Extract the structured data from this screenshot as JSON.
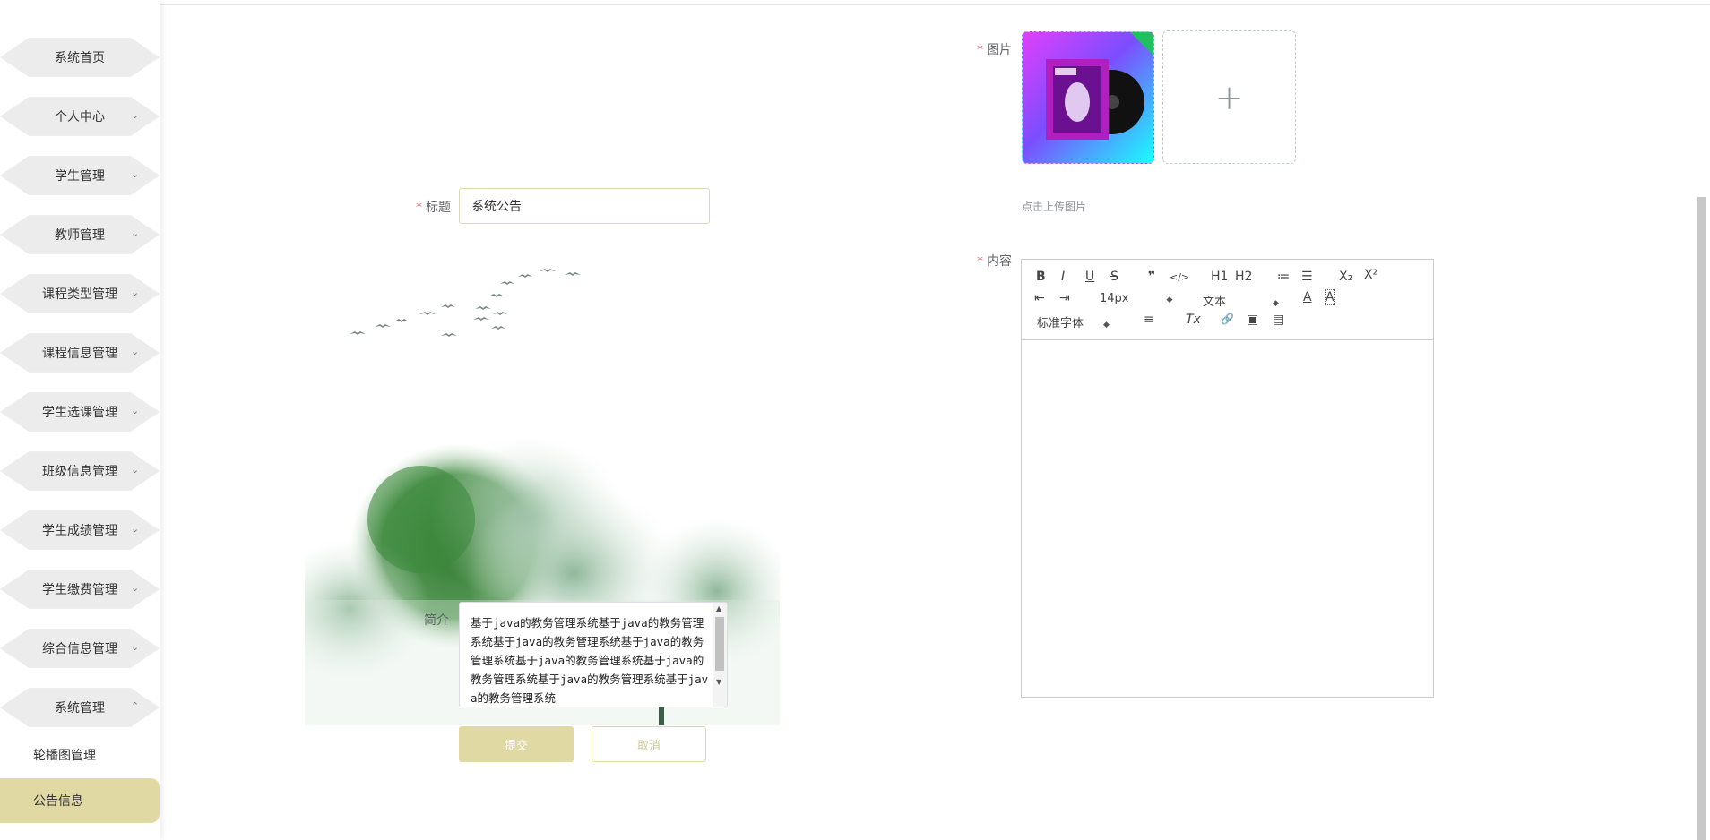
{
  "sidebar": {
    "items": [
      {
        "label": "系统首页",
        "has_chevron": false
      },
      {
        "label": "个人中心",
        "has_chevron": true,
        "chevron": "⌄"
      },
      {
        "label": "学生管理",
        "has_chevron": true,
        "chevron": "⌄"
      },
      {
        "label": "教师管理",
        "has_chevron": true,
        "chevron": "⌄"
      },
      {
        "label": "课程类型管理",
        "has_chevron": true,
        "chevron": "⌄"
      },
      {
        "label": "课程信息管理",
        "has_chevron": true,
        "chevron": "⌄"
      },
      {
        "label": "学生选课管理",
        "has_chevron": true,
        "chevron": "⌄"
      },
      {
        "label": "班级信息管理",
        "has_chevron": true,
        "chevron": "⌄"
      },
      {
        "label": "学生成绩管理",
        "has_chevron": true,
        "chevron": "⌄"
      },
      {
        "label": "学生缴费管理",
        "has_chevron": true,
        "chevron": "⌄"
      },
      {
        "label": "综合信息管理",
        "has_chevron": true,
        "chevron": "⌄"
      },
      {
        "label": "系统管理",
        "has_chevron": true,
        "chevron": "⌃"
      }
    ],
    "sub_items": [
      {
        "label": "轮播图管理",
        "active": false
      },
      {
        "label": "公告信息",
        "active": true
      }
    ]
  },
  "form": {
    "required_mark": "*",
    "title_label": "标题",
    "title_value": "系统公告",
    "intro_label": "简介",
    "intro_value": "基于java的教务管理系统基于java的教务管理系统基于java的教务管理系统基于java的教务管理系统基于java的教务管理系统基于java的教务管理系统基于java的教务管理系统基于java的教务管理系统",
    "submit_label": "提交",
    "cancel_label": "取消",
    "image_label": "图片",
    "upload_hint": "点击上传图片",
    "upload_plus": "+",
    "content_label": "内容"
  },
  "editor": {
    "toolbar": {
      "bold": "B",
      "italic": "I",
      "underline": "U",
      "strike": "S",
      "quote": "❞",
      "code": "</>",
      "h1": "H1",
      "h2": "H2",
      "ordered_list": "≔",
      "bullet_list": "☰",
      "subscript": "X₂",
      "superscript": "X²",
      "outdent": "⇤",
      "indent": "⇥",
      "size": "14px",
      "header": "文本",
      "font": "标准字体",
      "align": "≡",
      "clean": "Tx",
      "link": "🔗",
      "image": "▣",
      "video": "▤",
      "color": "A",
      "background": "A"
    }
  },
  "colors": {
    "accent": "#e0d9a3",
    "required": "#f56c6c",
    "menu_bg": "#ececec"
  }
}
